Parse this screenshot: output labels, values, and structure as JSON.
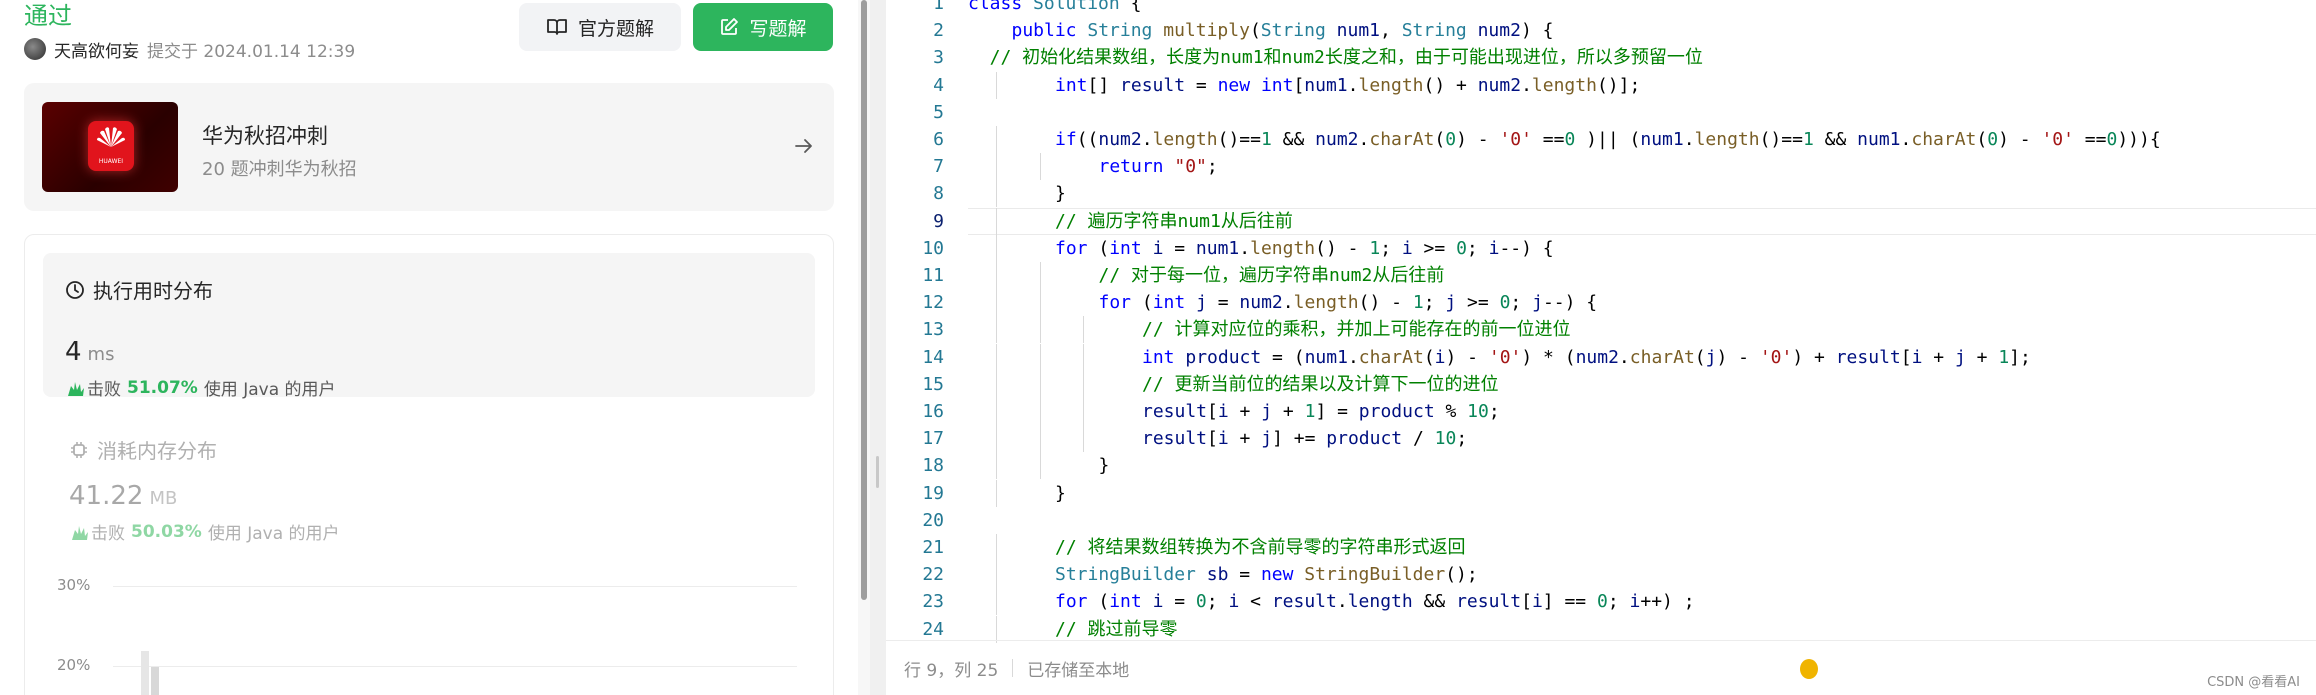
{
  "submission": {
    "status": "通过",
    "author": "天高欲何妄",
    "submitted_at": "提交于 2024.01.14 12:39",
    "official_solution_label": "官方题解",
    "write_solution_label": "写题解"
  },
  "promo": {
    "logo_text": "HUAWEI",
    "title": "华为秋招冲刺",
    "subtitle": "20 题冲刺华为秋招"
  },
  "runtime": {
    "heading": "执行用时分布",
    "value": "4",
    "unit": "ms",
    "beat_prefix": "击败",
    "beat_percent": "51.07%",
    "beat_suffix": "使用 Java 的用户"
  },
  "memory": {
    "heading": "消耗内存分布",
    "value": "41.22",
    "unit": "MB",
    "beat_prefix": "击败",
    "beat_percent": "50.03%",
    "beat_suffix": "使用 Java 的用户"
  },
  "chart_data": {
    "type": "bar",
    "ytick_labels": [
      "30%",
      "20%"
    ]
  },
  "editor": {
    "current_line": 9,
    "lines": [
      {
        "n": "1",
        "indent": 0,
        "tokens": [
          [
            "kw",
            "class"
          ],
          [
            "pl",
            " "
          ],
          [
            "tp",
            "Solution"
          ],
          [
            "pl",
            " {"
          ]
        ]
      },
      {
        "n": "2",
        "indent": 1,
        "tokens": [
          [
            "kw",
            "public"
          ],
          [
            "pl",
            " "
          ],
          [
            "tp",
            "String"
          ],
          [
            "pl",
            " "
          ],
          [
            "fn",
            "multiply"
          ],
          [
            "pl",
            "("
          ],
          [
            "tp",
            "String"
          ],
          [
            "pl",
            " "
          ],
          [
            "vr",
            "num1"
          ],
          [
            "pl",
            ", "
          ],
          [
            "tp",
            "String"
          ],
          [
            "pl",
            " "
          ],
          [
            "vr",
            "num2"
          ],
          [
            "pl",
            ") {"
          ]
        ]
      },
      {
        "n": "3",
        "indent": 0,
        "tokens": [
          [
            "cm",
            "  // 初始化结果数组，长度为num1和num2长度之和，由于可能出现进位，所以多预留一位"
          ]
        ]
      },
      {
        "n": "4",
        "indent": 2,
        "tokens": [
          [
            "kw",
            "int"
          ],
          [
            "pl",
            "[] "
          ],
          [
            "vr",
            "result"
          ],
          [
            "pl",
            " = "
          ],
          [
            "kw",
            "new"
          ],
          [
            "pl",
            " "
          ],
          [
            "kw",
            "int"
          ],
          [
            "pl",
            "["
          ],
          [
            "vr",
            "num1"
          ],
          [
            "pl",
            "."
          ],
          [
            "fn",
            "length"
          ],
          [
            "pl",
            "() + "
          ],
          [
            "vr",
            "num2"
          ],
          [
            "pl",
            "."
          ],
          [
            "fn",
            "length"
          ],
          [
            "pl",
            "()];"
          ]
        ]
      },
      {
        "n": "5",
        "indent": 0,
        "tokens": []
      },
      {
        "n": "6",
        "indent": 2,
        "tokens": [
          [
            "kw",
            "if"
          ],
          [
            "pl",
            "(("
          ],
          [
            "vr",
            "num2"
          ],
          [
            "pl",
            "."
          ],
          [
            "fn",
            "length"
          ],
          [
            "pl",
            "()=="
          ],
          [
            "num",
            "1"
          ],
          [
            "pl",
            " && "
          ],
          [
            "vr",
            "num2"
          ],
          [
            "pl",
            "."
          ],
          [
            "fn",
            "charAt"
          ],
          [
            "pl",
            "("
          ],
          [
            "num",
            "0"
          ],
          [
            "pl",
            ") - "
          ],
          [
            "str",
            "'0'"
          ],
          [
            "pl",
            " =="
          ],
          [
            "num",
            "0"
          ],
          [
            "pl",
            " )|| ("
          ],
          [
            "vr",
            "num1"
          ],
          [
            "pl",
            "."
          ],
          [
            "fn",
            "length"
          ],
          [
            "pl",
            "()=="
          ],
          [
            "num",
            "1"
          ],
          [
            "pl",
            " && "
          ],
          [
            "vr",
            "num1"
          ],
          [
            "pl",
            "."
          ],
          [
            "fn",
            "charAt"
          ],
          [
            "pl",
            "("
          ],
          [
            "num",
            "0"
          ],
          [
            "pl",
            ") - "
          ],
          [
            "str",
            "'0'"
          ],
          [
            "pl",
            " =="
          ],
          [
            "num",
            "0"
          ],
          [
            "pl",
            "))){"
          ]
        ]
      },
      {
        "n": "7",
        "indent": 3,
        "tokens": [
          [
            "kw",
            "return"
          ],
          [
            "pl",
            " "
          ],
          [
            "str",
            "\"0\""
          ],
          [
            "pl",
            ";"
          ]
        ]
      },
      {
        "n": "8",
        "indent": 2,
        "tokens": [
          [
            "pl",
            "}"
          ]
        ]
      },
      {
        "n": "9",
        "indent": 2,
        "tokens": [
          [
            "cm",
            "// 遍历字符串num1从后往前"
          ]
        ]
      },
      {
        "n": "10",
        "indent": 2,
        "tokens": [
          [
            "kw",
            "for"
          ],
          [
            "pl",
            " ("
          ],
          [
            "kw",
            "int"
          ],
          [
            "pl",
            " "
          ],
          [
            "vr",
            "i"
          ],
          [
            "pl",
            " = "
          ],
          [
            "vr",
            "num1"
          ],
          [
            "pl",
            "."
          ],
          [
            "fn",
            "length"
          ],
          [
            "pl",
            "() - "
          ],
          [
            "num",
            "1"
          ],
          [
            "pl",
            "; "
          ],
          [
            "vr",
            "i"
          ],
          [
            "pl",
            " >= "
          ],
          [
            "num",
            "0"
          ],
          [
            "pl",
            "; "
          ],
          [
            "vr",
            "i"
          ],
          [
            "pl",
            "--) {"
          ]
        ]
      },
      {
        "n": "11",
        "indent": 3,
        "tokens": [
          [
            "cm",
            "// 对于每一位，遍历字符串num2从后往前"
          ]
        ]
      },
      {
        "n": "12",
        "indent": 3,
        "tokens": [
          [
            "kw",
            "for"
          ],
          [
            "pl",
            " ("
          ],
          [
            "kw",
            "int"
          ],
          [
            "pl",
            " "
          ],
          [
            "vr",
            "j"
          ],
          [
            "pl",
            " = "
          ],
          [
            "vr",
            "num2"
          ],
          [
            "pl",
            "."
          ],
          [
            "fn",
            "length"
          ],
          [
            "pl",
            "() - "
          ],
          [
            "num",
            "1"
          ],
          [
            "pl",
            "; "
          ],
          [
            "vr",
            "j"
          ],
          [
            "pl",
            " >= "
          ],
          [
            "num",
            "0"
          ],
          [
            "pl",
            "; "
          ],
          [
            "vr",
            "j"
          ],
          [
            "pl",
            "--) {"
          ]
        ]
      },
      {
        "n": "13",
        "indent": 4,
        "tokens": [
          [
            "cm",
            "// 计算对应位的乘积，并加上可能存在的前一位进位"
          ]
        ]
      },
      {
        "n": "14",
        "indent": 4,
        "tokens": [
          [
            "kw",
            "int"
          ],
          [
            "pl",
            " "
          ],
          [
            "vr",
            "product"
          ],
          [
            "pl",
            " = ("
          ],
          [
            "vr",
            "num1"
          ],
          [
            "pl",
            "."
          ],
          [
            "fn",
            "charAt"
          ],
          [
            "pl",
            "("
          ],
          [
            "vr",
            "i"
          ],
          [
            "pl",
            ") - "
          ],
          [
            "str",
            "'0'"
          ],
          [
            "pl",
            ") * ("
          ],
          [
            "vr",
            "num2"
          ],
          [
            "pl",
            "."
          ],
          [
            "fn",
            "charAt"
          ],
          [
            "pl",
            "("
          ],
          [
            "vr",
            "j"
          ],
          [
            "pl",
            ") - "
          ],
          [
            "str",
            "'0'"
          ],
          [
            "pl",
            ") + "
          ],
          [
            "vr",
            "result"
          ],
          [
            "pl",
            "["
          ],
          [
            "vr",
            "i"
          ],
          [
            "pl",
            " + "
          ],
          [
            "vr",
            "j"
          ],
          [
            "pl",
            " + "
          ],
          [
            "num",
            "1"
          ],
          [
            "pl",
            "];"
          ]
        ]
      },
      {
        "n": "15",
        "indent": 4,
        "tokens": [
          [
            "cm",
            "// 更新当前位的结果以及计算下一位的进位"
          ]
        ]
      },
      {
        "n": "16",
        "indent": 4,
        "tokens": [
          [
            "vr",
            "result"
          ],
          [
            "pl",
            "["
          ],
          [
            "vr",
            "i"
          ],
          [
            "pl",
            " + "
          ],
          [
            "vr",
            "j"
          ],
          [
            "pl",
            " + "
          ],
          [
            "num",
            "1"
          ],
          [
            "pl",
            "] = "
          ],
          [
            "vr",
            "product"
          ],
          [
            "pl",
            " % "
          ],
          [
            "num",
            "10"
          ],
          [
            "pl",
            ";"
          ]
        ]
      },
      {
        "n": "17",
        "indent": 4,
        "tokens": [
          [
            "vr",
            "result"
          ],
          [
            "pl",
            "["
          ],
          [
            "vr",
            "i"
          ],
          [
            "pl",
            " + "
          ],
          [
            "vr",
            "j"
          ],
          [
            "pl",
            "] += "
          ],
          [
            "vr",
            "product"
          ],
          [
            "pl",
            " / "
          ],
          [
            "num",
            "10"
          ],
          [
            "pl",
            ";"
          ]
        ]
      },
      {
        "n": "18",
        "indent": 3,
        "tokens": [
          [
            "pl",
            "}"
          ]
        ]
      },
      {
        "n": "19",
        "indent": 2,
        "tokens": [
          [
            "pl",
            "}"
          ]
        ]
      },
      {
        "n": "20",
        "indent": 0,
        "tokens": []
      },
      {
        "n": "21",
        "indent": 2,
        "tokens": [
          [
            "cm",
            "// 将结果数组转换为不含前导零的字符串形式返回"
          ]
        ]
      },
      {
        "n": "22",
        "indent": 2,
        "tokens": [
          [
            "tp",
            "StringBuilder"
          ],
          [
            "pl",
            " "
          ],
          [
            "vr",
            "sb"
          ],
          [
            "pl",
            " = "
          ],
          [
            "kw",
            "new"
          ],
          [
            "pl",
            " "
          ],
          [
            "fn",
            "StringBuilder"
          ],
          [
            "pl",
            "();"
          ]
        ]
      },
      {
        "n": "23",
        "indent": 2,
        "tokens": [
          [
            "kw",
            "for"
          ],
          [
            "pl",
            " ("
          ],
          [
            "kw",
            "int"
          ],
          [
            "pl",
            " "
          ],
          [
            "vr",
            "i"
          ],
          [
            "pl",
            " = "
          ],
          [
            "num",
            "0"
          ],
          [
            "pl",
            "; "
          ],
          [
            "vr",
            "i"
          ],
          [
            "pl",
            " < "
          ],
          [
            "vr",
            "result"
          ],
          [
            "pl",
            "."
          ],
          [
            "vr",
            "length"
          ],
          [
            "pl",
            " && "
          ],
          [
            "vr",
            "result"
          ],
          [
            "pl",
            "["
          ],
          [
            "vr",
            "i"
          ],
          [
            "pl",
            "] == "
          ],
          [
            "num",
            "0"
          ],
          [
            "pl",
            "; "
          ],
          [
            "vr",
            "i"
          ],
          [
            "pl",
            "++) ;"
          ]
        ]
      },
      {
        "n": "24",
        "indent": 2,
        "tokens": [
          [
            "cm",
            "// 跳过前导零"
          ]
        ]
      }
    ],
    "footer": {
      "cursor_position": "行 9，列 25",
      "save_status": "已存储至本地"
    }
  },
  "watermark": "CSDN @看看AI"
}
